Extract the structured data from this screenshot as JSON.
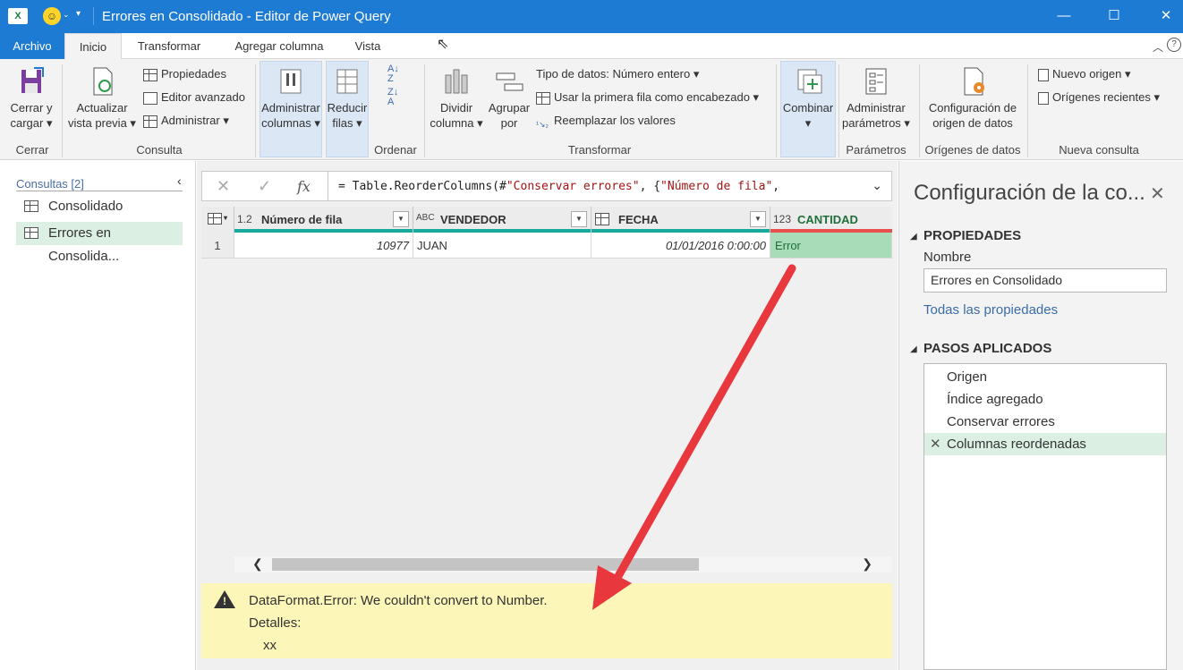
{
  "window": {
    "title": "Errores en Consolidado - Editor de Power Query",
    "app_icon": "X",
    "minimize": "—",
    "maximize": "☐",
    "close": "✕"
  },
  "tabs": [
    "Archivo",
    "Inicio",
    "Transformar",
    "Agregar columna",
    "Vista"
  ],
  "ribbon": {
    "cerrar_cargar": "Cerrar y\ncargar",
    "cerrar_cargar_l1": "Cerrar y",
    "cerrar_cargar_l2": "cargar",
    "group_cerrar": "Cerrar",
    "actualizar_l1": "Actualizar",
    "actualizar_l2": "vista previa",
    "propiedades": "Propiedades",
    "editor_avanzado": "Editor avanzado",
    "administrar": "Administrar",
    "group_consulta": "Consulta",
    "admin_col_l1": "Administrar",
    "admin_col_l2": "columnas",
    "reducir_l1": "Reducir",
    "reducir_l2": "filas",
    "group_ordenar": "Ordenar",
    "dividir_l1": "Dividir",
    "dividir_l2": "columna",
    "agrupar_l1": "Agrupar",
    "agrupar_l2": "por",
    "tipo_datos": "Tipo de datos: Número entero",
    "primera_fila": "Usar la primera fila como encabezado",
    "reemplazar": "Reemplazar los valores",
    "group_transformar": "Transformar",
    "combinar": "Combinar",
    "admin_param_l1": "Administrar",
    "admin_param_l2": "parámetros",
    "group_parametros": "Parámetros",
    "config_l1": "Configuración de",
    "config_l2": "origen de datos",
    "group_origenes": "Orígenes de datos",
    "nuevo_origen": "Nuevo origen",
    "origenes_recientes": "Orígenes recientes",
    "group_nueva": "Nueva consulta"
  },
  "queries": {
    "header": "Consultas [2]",
    "items": [
      "Consolidado",
      "Errores en Consolida..."
    ]
  },
  "formula": {
    "prefix": "= Table.ReorderColumns(#",
    "str1": "\"Conservar errores\"",
    "mid": ", {",
    "str2": "\"Número de fila\"",
    "suffix": ","
  },
  "grid": {
    "columns": [
      {
        "type": "1.2",
        "name": "Número de fila"
      },
      {
        "type": "ABC",
        "name": "VENDEDOR"
      },
      {
        "type": "date",
        "name": "FECHA"
      },
      {
        "type": "123",
        "name": "CANTIDAD"
      }
    ],
    "rows": [
      {
        "num": "1",
        "cells": [
          "10977",
          "JUAN",
          "01/01/2016 0:00:00",
          "Error"
        ]
      }
    ]
  },
  "error": {
    "message": "DataFormat.Error: We couldn't convert to Number.",
    "details_label": "Detalles:",
    "details_value": "xx"
  },
  "settings": {
    "title": "Configuración de la co...",
    "propiedades": "PROPIEDADES",
    "nombre_label": "Nombre",
    "nombre_value": "Errores en Consolidado",
    "todas": "Todas las propiedades",
    "pasos": "PASOS APLICADOS",
    "steps": [
      "Origen",
      "Índice agregado",
      "Conservar errores",
      "Columnas reordenadas"
    ]
  },
  "colors": {
    "titlebar": "#1e7bd4",
    "accent_green": "#17a99c",
    "error_red": "#e85050",
    "error_banner": "#fdf6b9",
    "arrow": "#e8383d"
  }
}
